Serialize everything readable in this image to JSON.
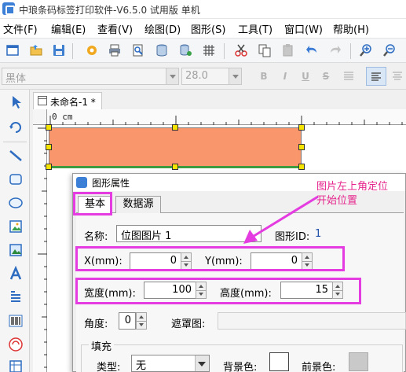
{
  "window": {
    "title": "中琅条码标签打印软件-V6.5.0 试用版 单机"
  },
  "menu": [
    "文件(F)",
    "编辑(E)",
    "查看(V)",
    "绘图(D)",
    "图形(S)",
    "工具(T)",
    "窗口(W)",
    "帮助(H)"
  ],
  "fontbar": {
    "font_name": "黑体",
    "font_size": "28.0",
    "bold": "B",
    "italic": "I",
    "underline": "U",
    "strike": "S"
  },
  "document": {
    "tab_title": "未命名-1 *",
    "ruler_label": "0 cm"
  },
  "shape": {
    "fill_color": "#f9966b"
  },
  "dialog": {
    "title": "图形属性",
    "tabs": [
      "基本",
      "数据源"
    ],
    "name_label": "名称:",
    "name_value": "位图图片 1",
    "shape_id_label": "图形ID:",
    "shape_id_value": "1",
    "x_label": "X(mm):",
    "x_value": "0",
    "y_label": "Y(mm):",
    "y_value": "0",
    "width_label": "宽度(mm):",
    "width_value": "100",
    "height_label": "高度(mm):",
    "height_value": "15",
    "angle_label": "角度:",
    "angle_value": "0",
    "mask_label": "遮罩图:",
    "fill_section": "填充",
    "type_label": "类型:",
    "type_value": "无",
    "bg_color_label": "背景色:",
    "fg_color_label": "前景色:"
  },
  "annotation": {
    "line1": "图片左上角定位",
    "line2": "开始位置",
    "color": "#e5258c"
  },
  "highlight_color": "#e43ce0"
}
